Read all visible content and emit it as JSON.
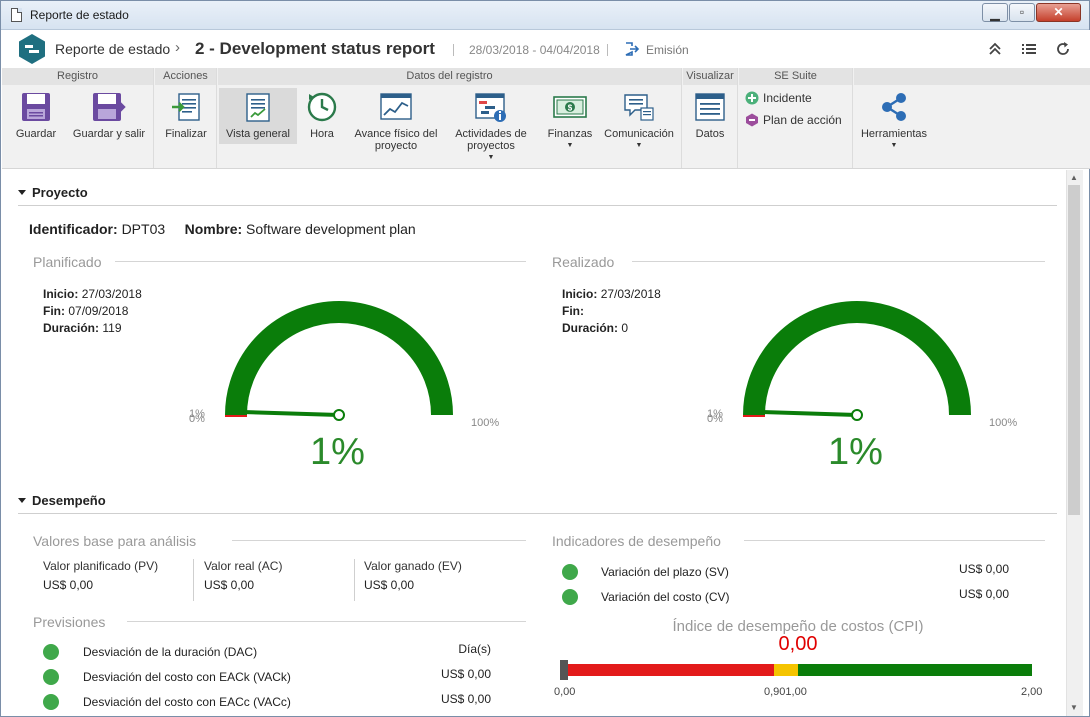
{
  "window": {
    "title": "Reporte de estado"
  },
  "header": {
    "breadcrumb_root": "Reporte de estado",
    "breadcrumb_sep": "›",
    "record_title": "2 - Development status report",
    "dates": "28/03/2018 - 04/04/2018",
    "emission_label": "Emisión"
  },
  "ribbon": {
    "groups": {
      "registro": "Registro",
      "acciones": "Acciones",
      "datos_registro": "Datos del registro",
      "visualizar": "Visualizar",
      "se_suite": "SE Suite"
    },
    "buttons": {
      "guardar": "Guardar",
      "guardar_salir": "Guardar y salir",
      "finalizar": "Finalizar",
      "vista_general": "Vista general",
      "hora": "Hora",
      "avance_l1": "Avance físico del",
      "avance_l2": "proyecto",
      "actividades_l1": "Actividades de",
      "actividades_l2": "proyectos",
      "finanzas": "Finanzas",
      "comunicacion": "Comunicación",
      "datos": "Datos",
      "incidente": "Incidente",
      "plan_accion": "Plan de acción",
      "herramientas": "Herramientas"
    }
  },
  "proyecto": {
    "section_title": "Proyecto",
    "identificador_label": "Identificador:",
    "identificador": "DPT03",
    "nombre_label": "Nombre:",
    "nombre": "Software development plan",
    "planificado": {
      "title": "Planificado",
      "inicio_label": "Inicio:",
      "inicio": "27/03/2018",
      "fin_label": "Fin:",
      "fin": "07/09/2018",
      "duracion_label": "Duración:",
      "duracion": "119",
      "gauge_min": "0%",
      "gauge_marker": "1%",
      "gauge_max": "100%",
      "gauge_value": "1%",
      "gauge_percent": 1
    },
    "realizado": {
      "title": "Realizado",
      "inicio_label": "Inicio:",
      "inicio": "27/03/2018",
      "fin_label": "Fin:",
      "fin": "",
      "duracion_label": "Duración:",
      "duracion": "0",
      "gauge_min": "0%",
      "gauge_marker": "1%",
      "gauge_max": "100%",
      "gauge_value": "1%",
      "gauge_percent": 1
    }
  },
  "desempeno": {
    "section_title": "Desempeño",
    "valores_base": {
      "title": "Valores base para análisis",
      "items": [
        {
          "label": "Valor planificado (PV)",
          "value": "US$ 0,00"
        },
        {
          "label": "Valor real (AC)",
          "value": "US$ 0,00"
        },
        {
          "label": "Valor ganado (EV)",
          "value": "US$ 0,00"
        }
      ]
    },
    "previsiones": {
      "title": "Previsiones",
      "items": [
        {
          "label": "Desviación de la duración (DAC)",
          "value": "Día(s)"
        },
        {
          "label": "Desviación del costo con EACk (VACk)",
          "value": "US$ 0,00"
        },
        {
          "label": "Desviación del costo con EACc (VACc)",
          "value": "US$ 0,00"
        }
      ]
    },
    "indicadores": {
      "title": "Indicadores de desempeño",
      "items": [
        {
          "label": "Variación del plazo (SV)",
          "value": "US$ 0,00"
        },
        {
          "label": "Variación del costo (CV)",
          "value": "US$ 0,00"
        }
      ]
    },
    "cpi": {
      "title": "Índice de desempeño de costos (CPI)",
      "value": "0,00",
      "scale_min": "0,00",
      "scale_mid": "0,901,00",
      "scale_max": "2,00"
    }
  },
  "colors": {
    "gauge_green": "#0a7d0a",
    "status_green": "#3fa84a",
    "cpi_red": "#e31a1a",
    "cpi_yellow": "#f5c400",
    "cpi_green": "#0a7d0a",
    "accent_teal": "#1f6f80"
  }
}
